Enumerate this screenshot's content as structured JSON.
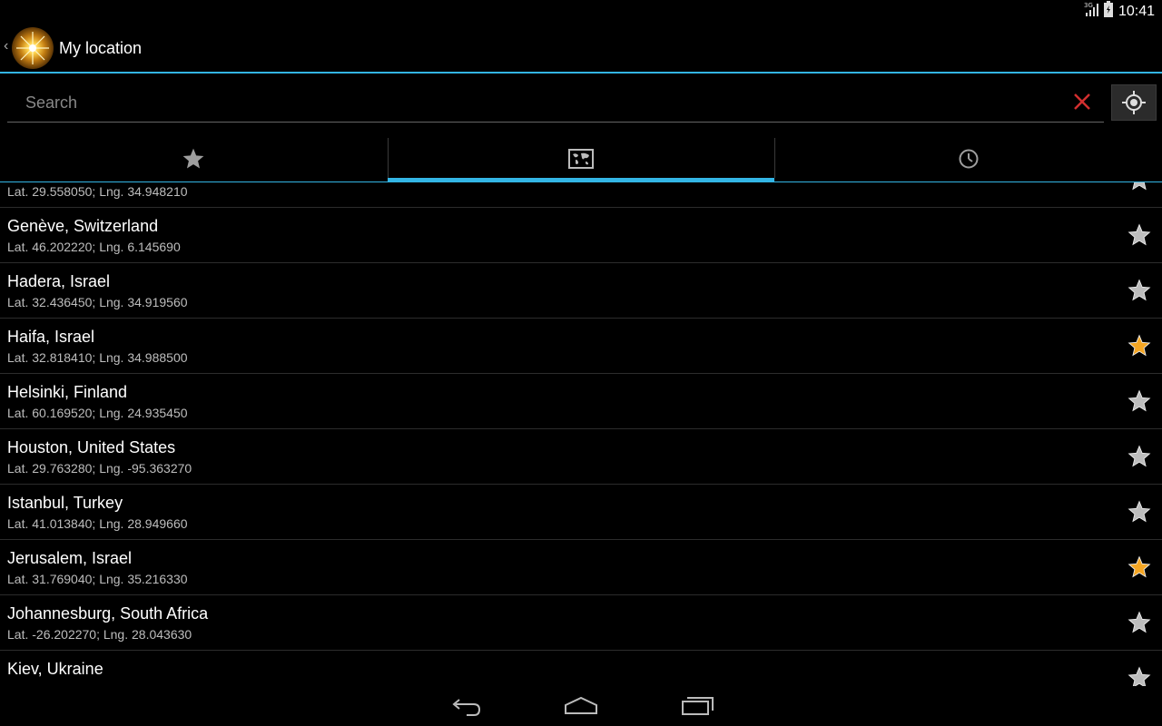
{
  "status": {
    "network": "3G",
    "time": "10:41"
  },
  "actionbar": {
    "title": "My location"
  },
  "search": {
    "placeholder": "Search",
    "value": ""
  },
  "tabs": [
    {
      "icon": "star-icon",
      "selected": false
    },
    {
      "icon": "map-icon",
      "selected": true
    },
    {
      "icon": "clock-icon",
      "selected": false
    }
  ],
  "colors": {
    "accent": "#33b5e5",
    "star_on": "#f5a623",
    "star_off": "#bdbdbd",
    "clear": "#d32f2f"
  },
  "locations": [
    {
      "name": "",
      "coords": "Lat. 29.558050; Lng. 34.948210",
      "favorite": false
    },
    {
      "name": "Genève, Switzerland",
      "coords": "Lat. 46.202220; Lng. 6.145690",
      "favorite": false
    },
    {
      "name": "Hadera, Israel",
      "coords": "Lat. 32.436450; Lng. 34.919560",
      "favorite": false
    },
    {
      "name": "Haifa, Israel",
      "coords": "Lat. 32.818410; Lng. 34.988500",
      "favorite": true
    },
    {
      "name": "Helsinki, Finland",
      "coords": "Lat. 60.169520; Lng. 24.935450",
      "favorite": false
    },
    {
      "name": "Houston, United States",
      "coords": "Lat. 29.763280; Lng. -95.363270",
      "favorite": false
    },
    {
      "name": "Istanbul, Turkey",
      "coords": "Lat. 41.013840; Lng. 28.949660",
      "favorite": false
    },
    {
      "name": "Jerusalem, Israel",
      "coords": "Lat. 31.769040; Lng. 35.216330",
      "favorite": true
    },
    {
      "name": "Johannesburg, South Africa",
      "coords": "Lat. -26.202270; Lng. 28.043630",
      "favorite": false
    },
    {
      "name": "Kiev, Ukraine",
      "coords": "",
      "favorite": false
    }
  ]
}
